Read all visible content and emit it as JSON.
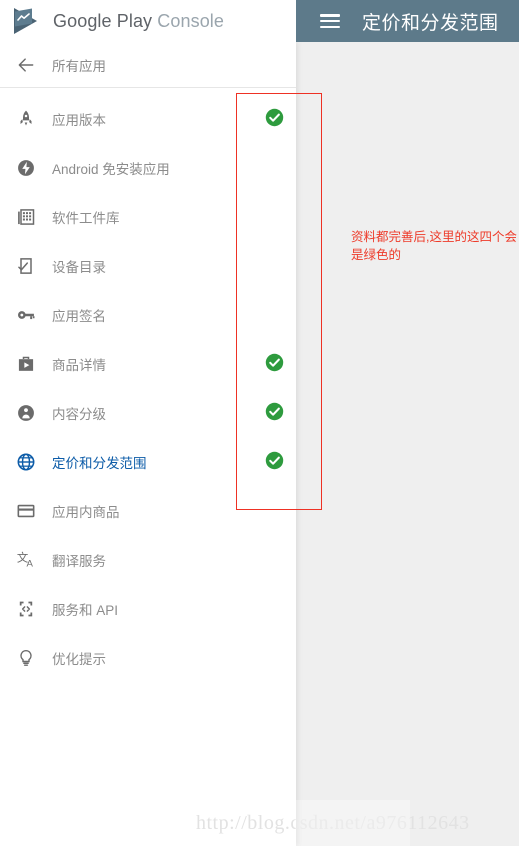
{
  "brand": {
    "logo_icon": "google-play-console-logo-icon",
    "name_strong": "Google Play",
    "name_light": "Console"
  },
  "appbar": {
    "menu_icon": "hamburger-menu-icon",
    "title": "定价和分发范围"
  },
  "sidebar": {
    "back": {
      "icon": "arrow-left-icon",
      "label": "所有应用"
    },
    "items": [
      {
        "icon": "rocket-icon",
        "label": "应用版本",
        "selected": false,
        "status": "complete"
      },
      {
        "icon": "bolt-circle-icon",
        "label": "Android 免安装应用",
        "selected": false,
        "status": "none"
      },
      {
        "icon": "library-grid-icon",
        "label": "软件工件库",
        "selected": false,
        "status": "none"
      },
      {
        "icon": "device-check-icon",
        "label": "设备目录",
        "selected": false,
        "status": "none"
      },
      {
        "icon": "key-icon",
        "label": "应用签名",
        "selected": false,
        "status": "none"
      },
      {
        "icon": "store-bag-icon",
        "label": "商品详情",
        "selected": false,
        "status": "complete"
      },
      {
        "icon": "person-badge-icon",
        "label": "内容分级",
        "selected": false,
        "status": "complete"
      },
      {
        "icon": "globe-icon",
        "label": "定价和分发范围",
        "selected": true,
        "status": "complete"
      },
      {
        "icon": "credit-card-icon",
        "label": "应用内商品",
        "selected": false,
        "status": "none"
      },
      {
        "icon": "translate-icon",
        "label": "翻译服务",
        "selected": false,
        "status": "none"
      },
      {
        "icon": "code-device-icon",
        "label": "服务和 API",
        "selected": false,
        "status": "none"
      },
      {
        "icon": "lightbulb-icon",
        "label": "优化提示",
        "selected": false,
        "status": "none"
      }
    ]
  },
  "annotation": {
    "text": "资料都完善后,这里的这四个会是绿色的",
    "box_name": "red-highlight-rectangle",
    "color": "#ee3124"
  },
  "status": {
    "check_icon": "green-check-circle-icon",
    "color": "#2e9b3e"
  },
  "watermark": {
    "text": "http://blog.csdn.net/a976112643"
  },
  "colors": {
    "appbar_bg": "#5d7a8a",
    "panel_bg": "#ffffff",
    "page_bg": "#efefef",
    "selected_blue": "#0d5ca8",
    "label_gray": "#8c8c8c"
  }
}
